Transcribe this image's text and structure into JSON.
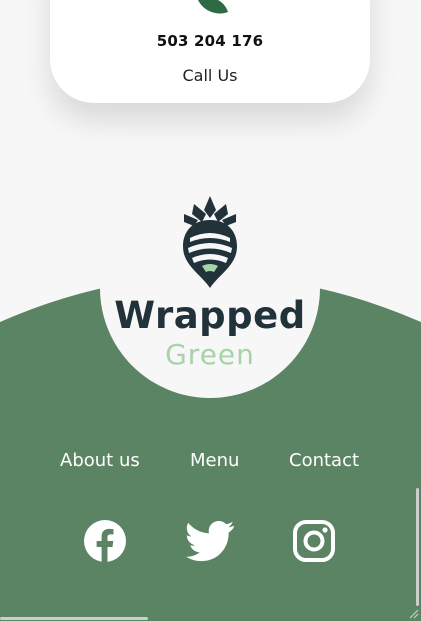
{
  "contact_card": {
    "phone": "503 204 176",
    "call_label": "Call Us"
  },
  "brand": {
    "name": "Wrapped",
    "tagline": "Green"
  },
  "footer_nav": [
    {
      "label": "About us"
    },
    {
      "label": "Menu"
    },
    {
      "label": "Contact"
    }
  ],
  "social": [
    {
      "icon": "facebook-icon"
    },
    {
      "icon": "twitter-icon"
    },
    {
      "icon": "instagram-icon"
    }
  ],
  "colors": {
    "footer_green": "#5a8463",
    "brand_dark": "#22323a",
    "brand_light_green": "#a7d3a9",
    "page_bg": "#f7f7f8"
  }
}
